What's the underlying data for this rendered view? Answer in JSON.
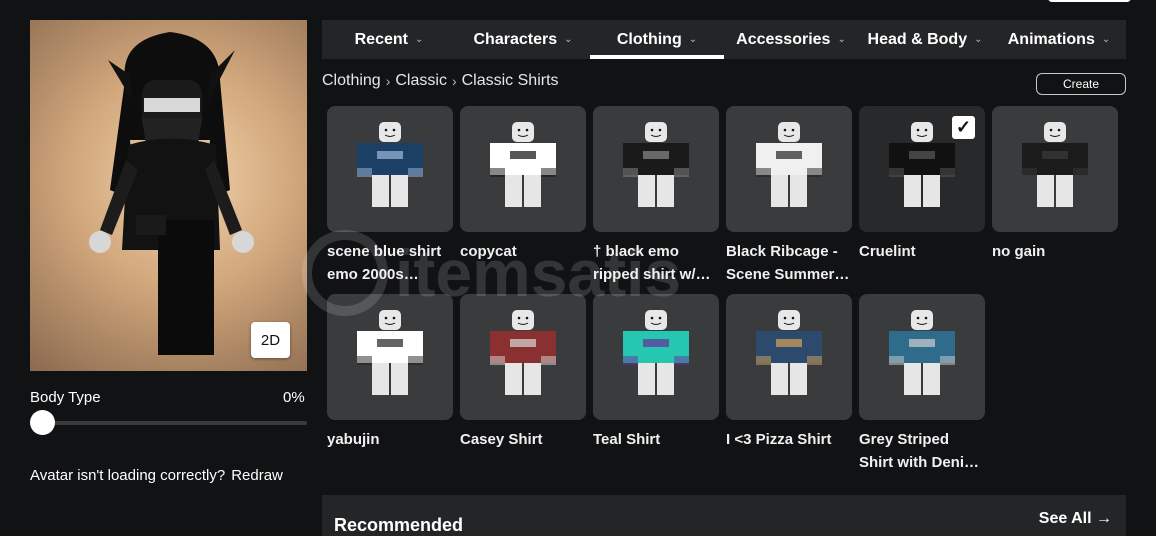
{
  "categories": [
    {
      "label": "Recent",
      "active": false
    },
    {
      "label": "Characters",
      "active": false
    },
    {
      "label": "Clothing",
      "active": true
    },
    {
      "label": "Accessories",
      "active": false
    },
    {
      "label": "Head & Body",
      "active": false
    },
    {
      "label": "Animations",
      "active": false
    }
  ],
  "breadcrumb": [
    "Clothing",
    "Classic",
    "Classic Shirts"
  ],
  "create_label": "Create",
  "avatar": {
    "toggle_label": "2D"
  },
  "body_type": {
    "label": "Body Type",
    "value": "0%",
    "level": 0
  },
  "redraw": {
    "question": "Avatar isn't loading correctly?",
    "link": "Redraw"
  },
  "items": [
    {
      "name": "scene blue shirt emo 2000s…",
      "shirt": "#1c3f66",
      "accent": "#9fb9d8",
      "selected": false
    },
    {
      "name": "copycat",
      "shirt": "#ffffff",
      "accent": "#111111",
      "selected": false
    },
    {
      "name": "† black emo ripped shirt w/…",
      "shirt": "#1a1a1a",
      "accent": "#8c8c8c",
      "selected": false
    },
    {
      "name": "Black Ribcage - Scene Summer…",
      "shirt": "#f0f0f0",
      "accent": "#222222",
      "selected": false
    },
    {
      "name": "Cruelint",
      "shirt": "#111111",
      "accent": "#5a5a5a",
      "selected": true
    },
    {
      "name": "no gain",
      "shirt": "#1b1b1b",
      "accent": "#3a3a3a",
      "selected": false
    },
    {
      "name": "yabujin",
      "shirt": "#ffffff",
      "accent": "#222222",
      "selected": false
    },
    {
      "name": "Casey Shirt",
      "shirt": "#8a3030",
      "accent": "#d9d9d9",
      "selected": false
    },
    {
      "name": "Teal Shirt",
      "shirt": "#25c7b0",
      "accent": "#6a2fa0",
      "selected": false
    },
    {
      "name": "I <3 Pizza Shirt",
      "shirt": "#2c4a6b",
      "accent": "#d9a25a",
      "selected": false
    },
    {
      "name": "Grey Striped Shirt with Deni…",
      "shirt": "#2f6b8a",
      "accent": "#cfcfcf",
      "selected": false
    }
  ],
  "recommended": {
    "title": "Recommended",
    "see_all": "See All →"
  }
}
